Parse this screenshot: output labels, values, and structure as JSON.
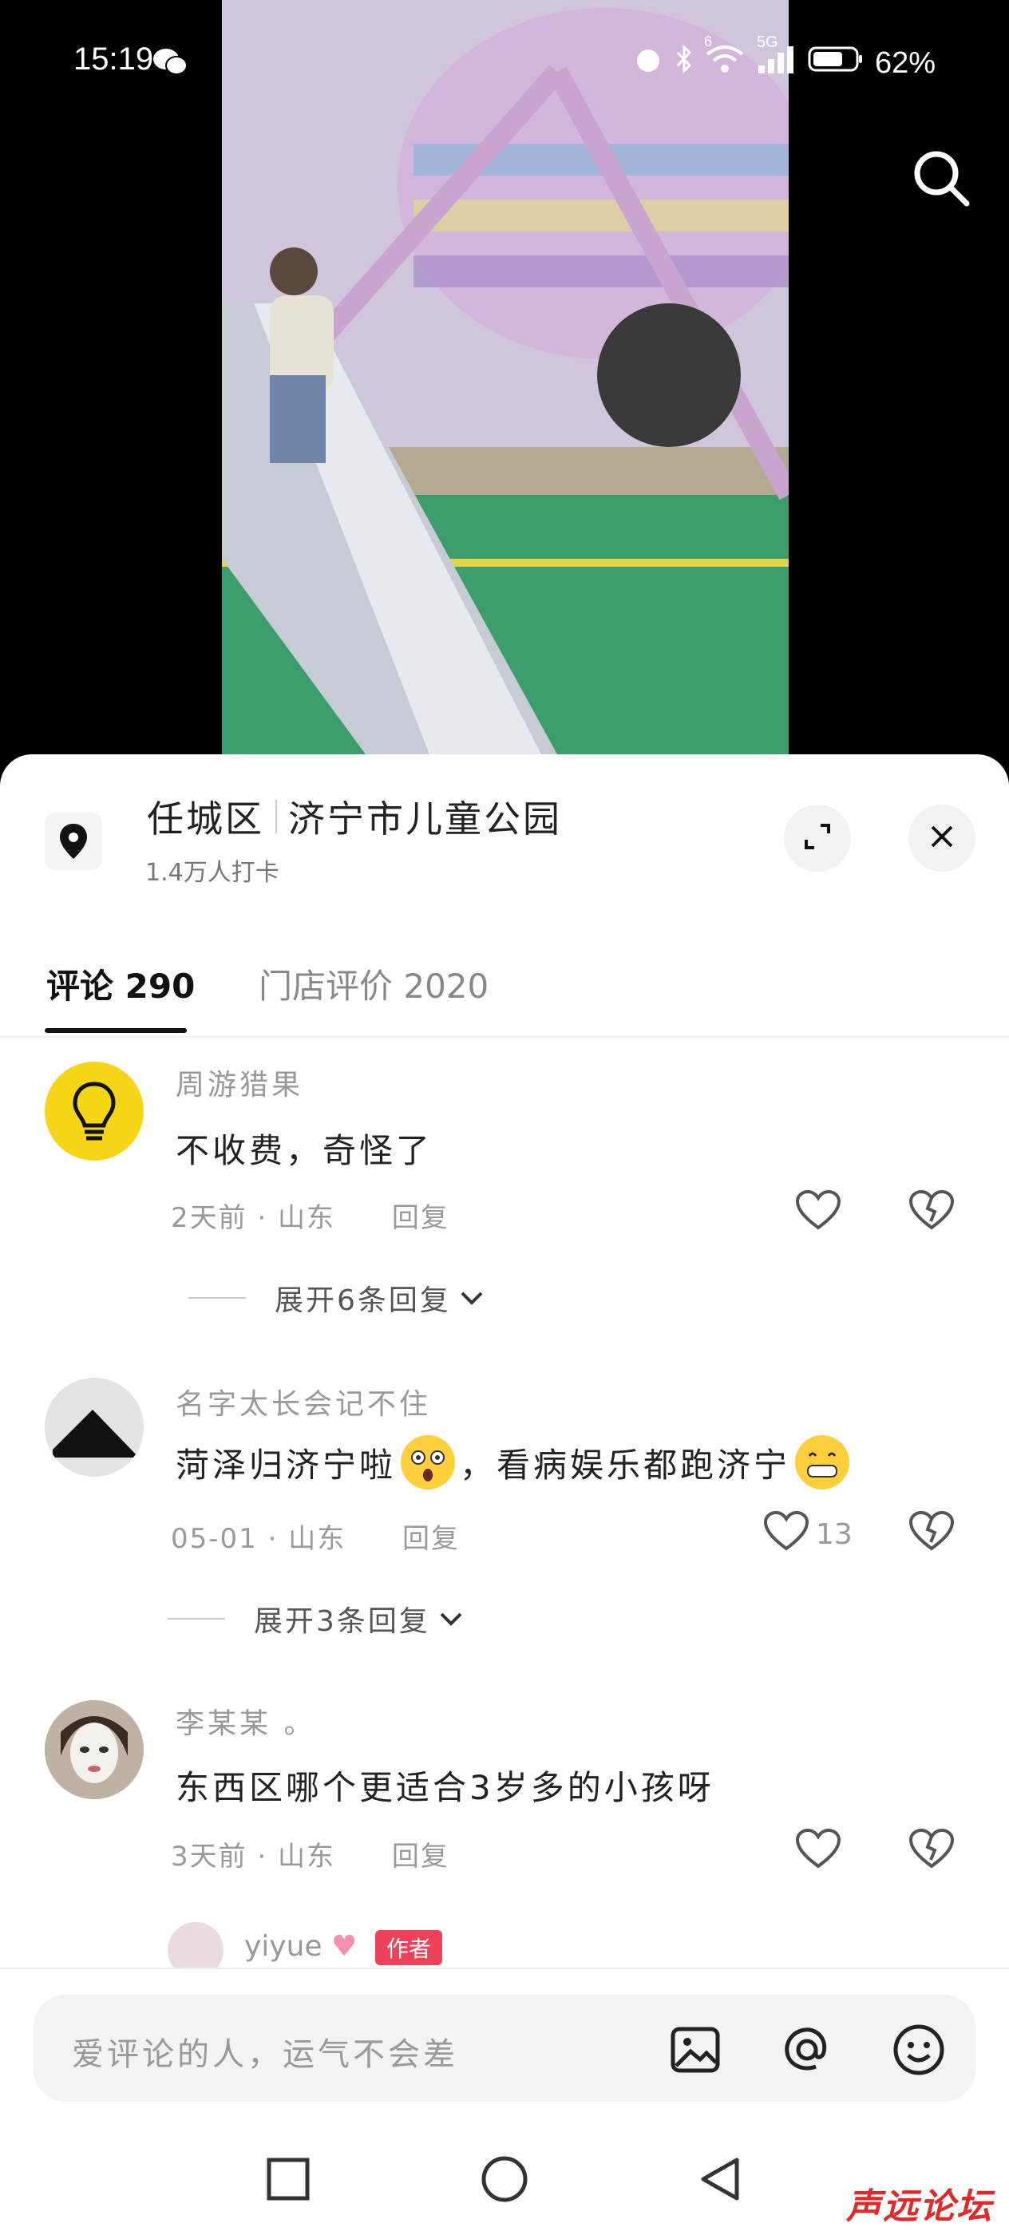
{
  "status_bar": {
    "time": "15:19",
    "battery": "62%",
    "signal_labels": [
      "6",
      "5G"
    ]
  },
  "location": {
    "district": "任城区",
    "place": "济宁市儿童公园",
    "checkins": "1.4万人打卡"
  },
  "tabs": [
    {
      "label": "评论 290",
      "active": true
    },
    {
      "label": "门店评价 2020",
      "active": false
    }
  ],
  "comments": [
    {
      "user": "周游猎果",
      "text": "不收费，奇怪了",
      "meta": "2天前 · 山东",
      "reply_label": "回复",
      "likes": "",
      "expand": "展开6条回复"
    },
    {
      "user": "名字太长会记不住",
      "text_before": "菏泽归济宁啦",
      "text_after": "，看病娱乐都跑济宁",
      "meta": "05-01 · 山东",
      "reply_label": "回复",
      "likes": "13",
      "expand": "展开3条回复"
    },
    {
      "user": "李某某 。",
      "text": "东西区哪个更适合3岁多的小孩呀",
      "meta": "3天前 · 山东",
      "reply_label": "回复",
      "likes": ""
    }
  ],
  "reply_preview": {
    "user": "yiyue",
    "badge": "作者"
  },
  "input": {
    "placeholder": "爱评论的人，运气不会差"
  },
  "watermark": "声远论坛",
  "colors": {
    "accent_badge": "#f0415a",
    "sheet_bg": "#ffffff",
    "muted_text": "#999999"
  },
  "icons": [
    "wechat-icon",
    "alarm-icon",
    "bluetooth-icon",
    "wifi-icon",
    "signal-icon",
    "battery-icon",
    "search-icon",
    "location-pin-icon",
    "expand-icon",
    "close-icon",
    "heart-icon",
    "broken-heart-icon",
    "chevron-down-icon",
    "image-icon",
    "at-icon",
    "emoji-icon",
    "square-nav-icon",
    "circle-nav-icon",
    "back-nav-icon"
  ]
}
